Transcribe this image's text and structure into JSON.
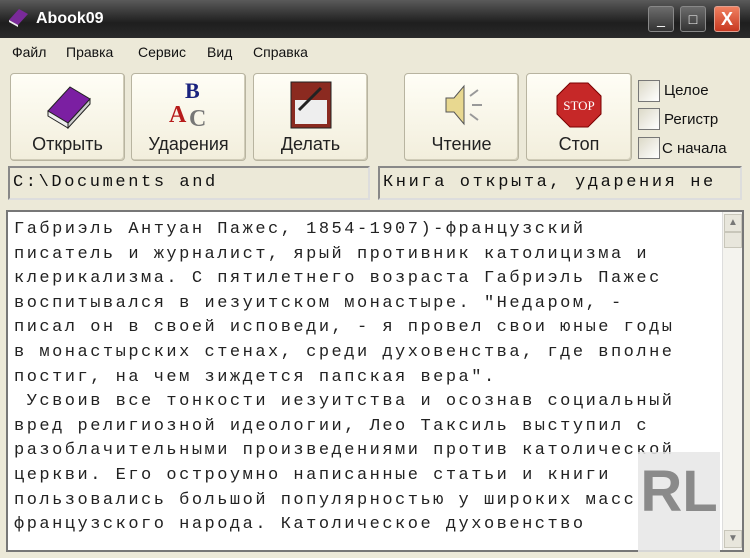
{
  "window": {
    "title": "Abook09",
    "minimize": "_",
    "maximize": "□",
    "close": "X"
  },
  "menu": [
    "Файл",
    "Правка",
    "Сервис",
    "Вид",
    "Справка"
  ],
  "toolbar": {
    "open": "Открыть",
    "stress": "Ударения",
    "make": "Делать",
    "read": "Чтение",
    "stop": "Стоп",
    "stop_sign": "STOP"
  },
  "options": [
    "Целое",
    "Регистр",
    "С начала"
  ],
  "fields": {
    "path": "C:\\Documents and",
    "status": "Книга открыта, ударения не"
  },
  "text_lines": [
    "Габриэль Антуан Пажес, 1854-1907)-французский",
    "писатель и журналист, ярый противник католицизма и",
    "клерикализма. С пятилетнего возраста Габриэль Пажес",
    "воспитывался в иезуитском монастыре. \"Недаром, -",
    "писал он в своей исповеди, - я провел свои юные годы",
    "в монастырских стенах, среди духовенства, где вполне",
    "постиг, на чем зиждется папская вера\".",
    " Усвоив все тонкости иезуитства и осознав социальный",
    "вред религиозной идеологии, Лео Таксиль выступил с",
    "разоблачительными произведениями против католической",
    "церкви. Его остроумно написанные статьи и книги",
    "пользовались большой популярностью у широких масс",
    "французского народа. Католическое духовенство"
  ],
  "watermark": "RL"
}
